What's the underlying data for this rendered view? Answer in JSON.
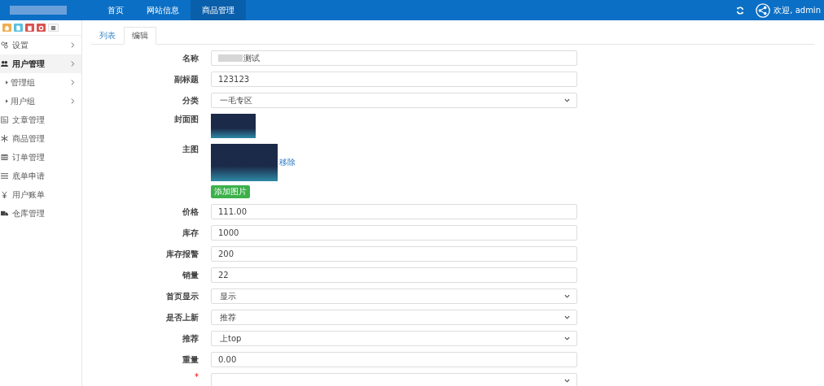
{
  "top_nav": {
    "items": [
      {
        "label": "首页",
        "selected": false
      },
      {
        "label": "网站信息",
        "selected": false
      },
      {
        "label": "商品管理",
        "selected": true
      }
    ],
    "welcome": "欢迎, admin"
  },
  "sidebar": {
    "toolbar": [
      {
        "color": "#f0ad4e"
      },
      {
        "color": "#5bc0de"
      },
      {
        "color": "#d9534f"
      },
      {
        "color": "#d9534f"
      },
      {
        "kind": "plain"
      }
    ],
    "items": [
      {
        "label": "设置",
        "selected": false,
        "has_arrow": true
      },
      {
        "label": "用户管理",
        "selected": true,
        "has_arrow": true,
        "children": [
          {
            "label": "管理组",
            "has_arrow": true
          },
          {
            "label": "用户组",
            "has_arrow": true
          }
        ]
      },
      {
        "label": "文章管理",
        "selected": false,
        "has_arrow": false
      },
      {
        "label": "商品管理",
        "selected": false,
        "has_arrow": false
      },
      {
        "label": "订单管理",
        "selected": false,
        "has_arrow": false
      },
      {
        "label": "底单申请",
        "selected": false,
        "has_arrow": false
      },
      {
        "label": "用户账单",
        "selected": false,
        "has_arrow": false
      },
      {
        "label": "仓库管理",
        "selected": false,
        "has_arrow": false
      }
    ]
  },
  "tabs": [
    {
      "label": "列表",
      "selected": false
    },
    {
      "label": "编辑",
      "selected": true
    }
  ],
  "form": [
    {
      "kind": "input",
      "label": "名称",
      "value": "测试",
      "blurred_prefix": true
    },
    {
      "kind": "input",
      "label": "副标题",
      "value": "123123"
    },
    {
      "kind": "select",
      "label": "分类",
      "value": "一毛专区"
    },
    {
      "kind": "image",
      "label": "封面图"
    },
    {
      "kind": "images",
      "label": "主图",
      "remove": "移除",
      "add": "添加图片"
    },
    {
      "kind": "input",
      "label": "价格",
      "value": "111.00"
    },
    {
      "kind": "input",
      "label": "库存",
      "value": "1000"
    },
    {
      "kind": "input",
      "label": "库存报警",
      "value": "200"
    },
    {
      "kind": "input",
      "label": "销量",
      "value": "22"
    },
    {
      "kind": "select",
      "label": "首页显示",
      "value": "显示"
    },
    {
      "kind": "select",
      "label": "是否上新",
      "value": "推荐"
    },
    {
      "kind": "select",
      "label": "推荐",
      "value": "上top"
    },
    {
      "kind": "input",
      "label": "重量",
      "value": "0.00"
    },
    {
      "kind": "select",
      "mark": "*"
    }
  ]
}
